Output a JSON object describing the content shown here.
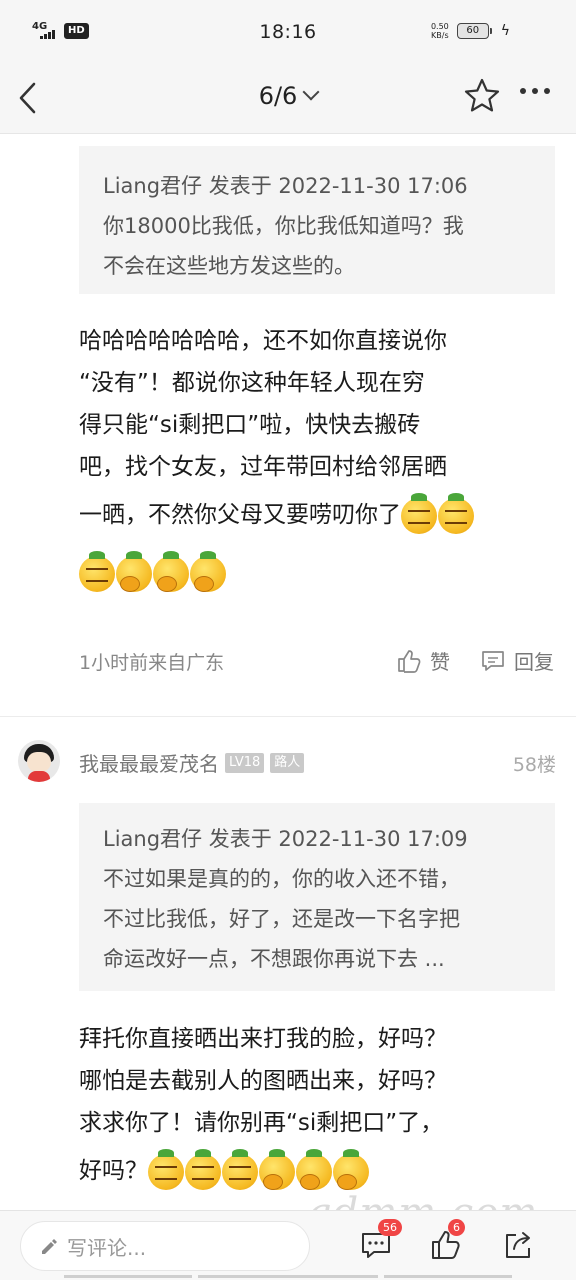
{
  "status_bar": {
    "network": "4G",
    "hd_label": "HD",
    "time": "18:16",
    "speed_value": "0.50",
    "speed_unit": "KB/s",
    "battery": "60"
  },
  "nav": {
    "title": "6/6"
  },
  "post_prev": {
    "quote_header": "Liang君仔 发表于 2022-11-30 17:06",
    "quote_lines": [
      "你18000比我低，你比我低知道吗？我",
      "不会在这些地方发这些的。"
    ],
    "body_lines": [
      "哈哈哈哈哈哈哈，还不如你直接说你",
      "“没有”！都说你这种年轻人现在穷",
      "得只能“si剩把口”啦，快快去搬砖",
      "吧，找个女友，过年带回村给邻居晒",
      "一晒，不然你父母又要唠叨你了"
    ],
    "meta": "1小时前来自广东",
    "like_label": "赞",
    "reply_label": "回复"
  },
  "post_58": {
    "username": "我最最最爱茂名",
    "level_badge": "LV18",
    "role_badge": "路人",
    "floor": "58楼",
    "quote_header": "Liang君仔 发表于 2022-11-30 17:09",
    "quote_lines": [
      "不过如果是真的的，你的收入还不错，",
      "不过比我低，好了，还是改一下名字把",
      "命运改好一点，不想跟你再说下去 ..."
    ],
    "body_lines": [
      "拜托你直接晒出来打我的脸，好吗？",
      "哪怕是去截别人的图晒出来，好吗？",
      "求求你了！请你别再“si剩把口”了，",
      "好吗？"
    ]
  },
  "bottom_bar": {
    "comment_placeholder": "写评论...",
    "comment_count": "56",
    "like_count": "6"
  },
  "watermark": "gdmm.com",
  "colors": {
    "badge_red": "#f04545",
    "emoji_yellow": "#f5b820"
  }
}
